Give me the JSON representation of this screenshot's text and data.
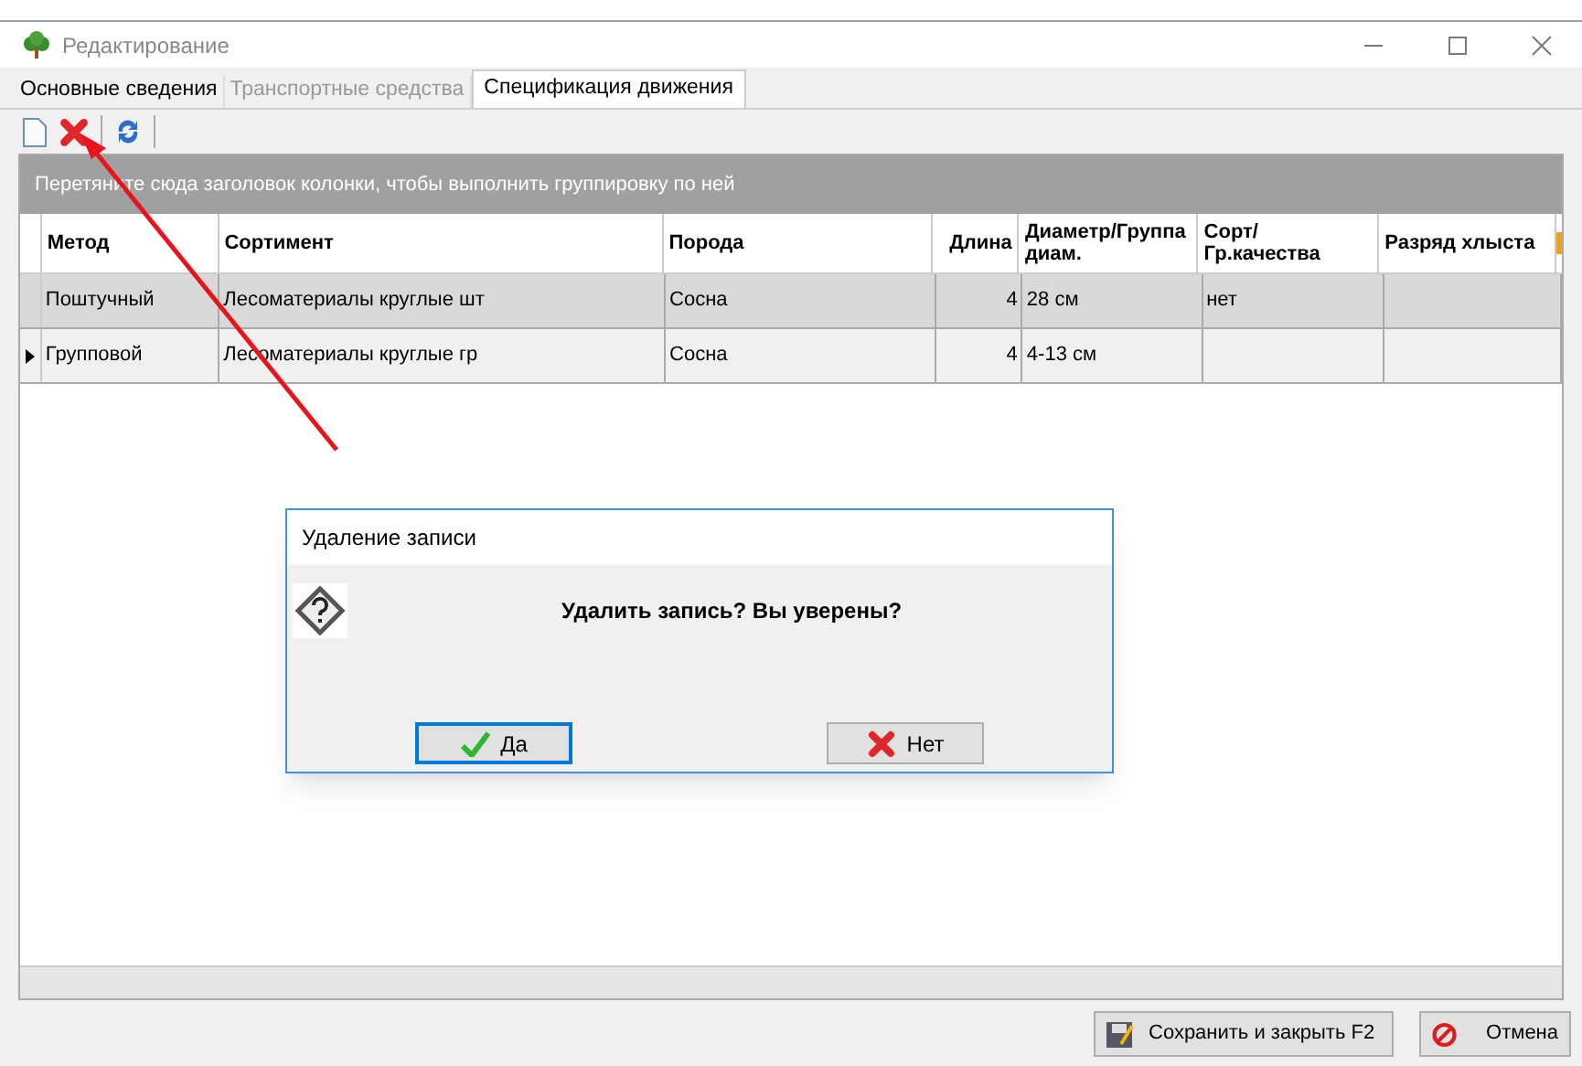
{
  "window": {
    "title": "Редактирование"
  },
  "tabs": [
    {
      "label": "Основные сведения",
      "selected": false,
      "disabled": false
    },
    {
      "label": "Транспортные средства",
      "selected": false,
      "disabled": true
    },
    {
      "label": "Спецификация движения",
      "selected": true,
      "disabled": false
    }
  ],
  "group_panel": {
    "hint": "Перетяните сюда заголовок колонки, чтобы выполнить группировку по ней"
  },
  "table": {
    "columns": [
      "Метод",
      "Сортимент",
      "Порода",
      "Длина",
      "Диаметр/Группа диам.",
      "Сорт/Гр.качества",
      "Разряд хлыста"
    ],
    "rows": [
      {
        "selected": true,
        "current": false,
        "cells": [
          "Поштучный",
          "Лесоматериалы круглые шт",
          "Сосна",
          "4",
          "28 см",
          "нет",
          ""
        ]
      },
      {
        "selected": false,
        "current": true,
        "cells": [
          "Групповой",
          "Лесоматериалы круглые гр",
          "Сосна",
          "4",
          "4-13 см",
          "",
          ""
        ]
      }
    ]
  },
  "dialog": {
    "title": "Удаление записи",
    "message": "Удалить запись? Вы уверены?",
    "buttons": [
      {
        "kind": "yes",
        "label": "Да",
        "focused": true
      },
      {
        "kind": "no",
        "label": "Нет",
        "focused": false
      }
    ]
  },
  "footer_buttons": [
    {
      "kind": "save",
      "label": "Сохранить и закрыть F2"
    },
    {
      "kind": "cancel",
      "label": "Отмена"
    }
  ]
}
